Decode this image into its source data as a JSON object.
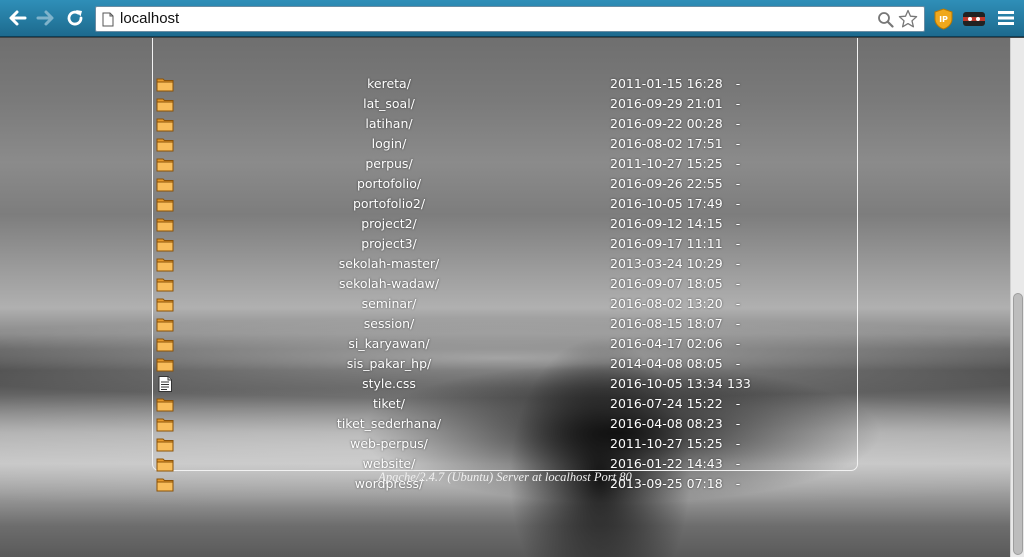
{
  "browser": {
    "url": "localhost"
  },
  "listing": {
    "rows": [
      {
        "type": "folder",
        "name": "kereta/",
        "date": "2011-01-15 16:28",
        "size": "-"
      },
      {
        "type": "folder",
        "name": "lat_soal/",
        "date": "2016-09-29 21:01",
        "size": "-"
      },
      {
        "type": "folder",
        "name": "latihan/",
        "date": "2016-09-22 00:28",
        "size": "-"
      },
      {
        "type": "folder",
        "name": "login/",
        "date": "2016-08-02 17:51",
        "size": "-"
      },
      {
        "type": "folder",
        "name": "perpus/",
        "date": "2011-10-27 15:25",
        "size": "-"
      },
      {
        "type": "folder",
        "name": "portofolio/",
        "date": "2016-09-26 22:55",
        "size": "-"
      },
      {
        "type": "folder",
        "name": "portofolio2/",
        "date": "2016-10-05 17:49",
        "size": "-"
      },
      {
        "type": "folder",
        "name": "project2/",
        "date": "2016-09-12 14:15",
        "size": "-"
      },
      {
        "type": "folder",
        "name": "project3/",
        "date": "2016-09-17 11:11",
        "size": "-"
      },
      {
        "type": "folder",
        "name": "sekolah-master/",
        "date": "2013-03-24 10:29",
        "size": "-"
      },
      {
        "type": "folder",
        "name": "sekolah-wadaw/",
        "date": "2016-09-07 18:05",
        "size": "-"
      },
      {
        "type": "folder",
        "name": "seminar/",
        "date": "2016-08-02 13:20",
        "size": "-"
      },
      {
        "type": "folder",
        "name": "session/",
        "date": "2016-08-15 18:07",
        "size": "-"
      },
      {
        "type": "folder",
        "name": "si_karyawan/",
        "date": "2016-04-17 02:06",
        "size": "-"
      },
      {
        "type": "folder",
        "name": "sis_pakar_hp/",
        "date": "2014-04-08 08:05",
        "size": "-"
      },
      {
        "type": "file",
        "name": "style.css",
        "date": "2016-10-05 13:34",
        "size": "133"
      },
      {
        "type": "folder",
        "name": "tiket/",
        "date": "2016-07-24 15:22",
        "size": "-"
      },
      {
        "type": "folder",
        "name": "tiket_sederhana/",
        "date": "2016-04-08 08:23",
        "size": "-"
      },
      {
        "type": "folder",
        "name": "web-perpus/",
        "date": "2011-10-27 15:25",
        "size": "-"
      },
      {
        "type": "folder",
        "name": "website/",
        "date": "2016-01-22 14:43",
        "size": "-"
      },
      {
        "type": "folder",
        "name": "wordpress/",
        "date": "2013-09-25 07:18",
        "size": "-"
      }
    ]
  },
  "footer": {
    "server_signature": "Apache/2.4.7 (Ubuntu) Server at localhost Port 80"
  },
  "icons": {
    "folder": "folder-icon",
    "file": "file-icon"
  },
  "colors": {
    "toolbar": "#2a7fa6",
    "folder": "#f6b24a",
    "text": "#ffffff"
  }
}
